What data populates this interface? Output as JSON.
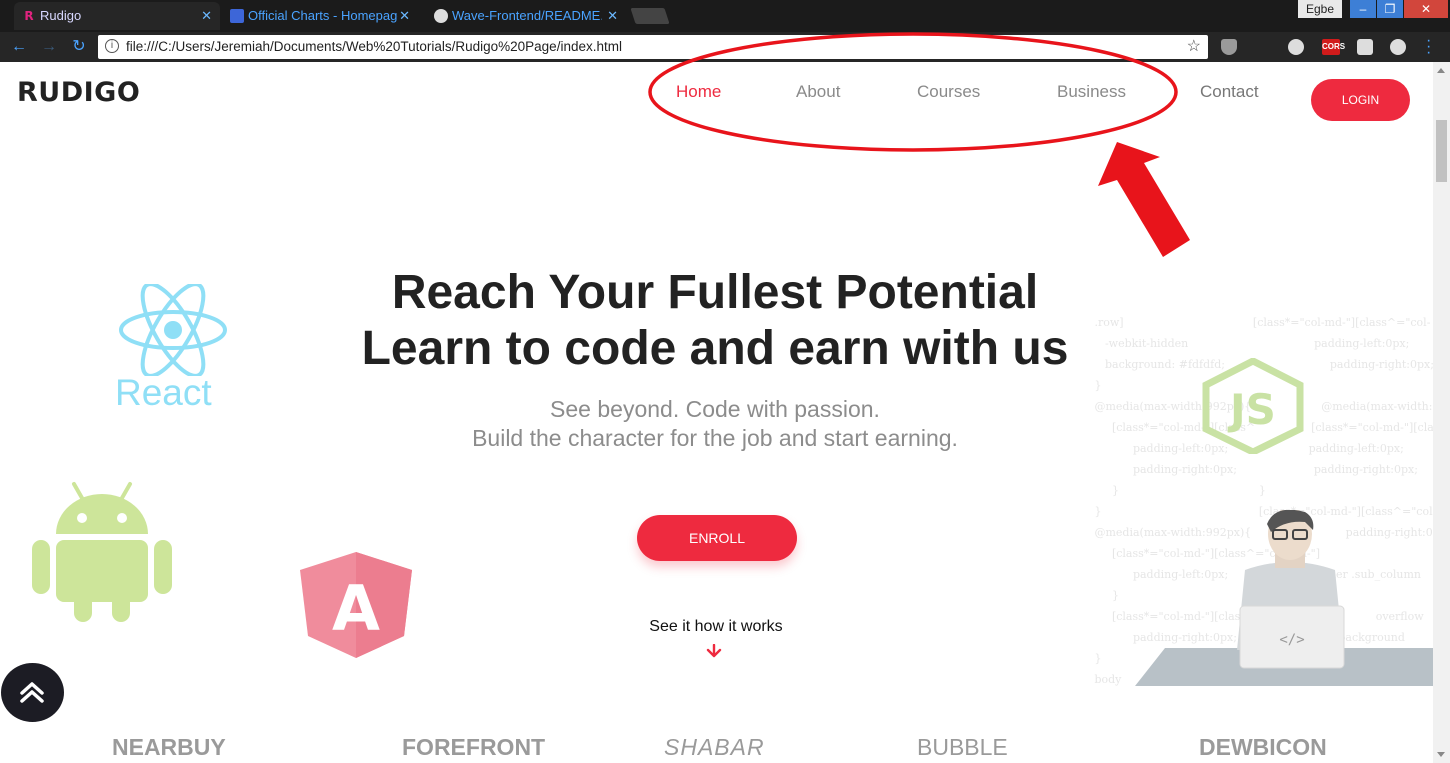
{
  "browser": {
    "tabs": [
      {
        "title": "Rudigo",
        "favicon": "rudigo-r-icon"
      },
      {
        "title": "Official Charts - Homepage",
        "favicon": "official-charts-icon"
      },
      {
        "title": "Wave-Frontend/README.md",
        "favicon": "github-icon"
      }
    ],
    "profile": "Egbe",
    "url": "file:///C:/Users/Jeremiah/Documents/Web%20Tutorials/Rudigo%20Page/index.html",
    "extensions": {
      "cors_label": "CORS"
    },
    "window_controls": {
      "min": "–",
      "max": "❐",
      "close": "✕"
    }
  },
  "page": {
    "logo": "RUDIGO",
    "nav": [
      "Home",
      "About",
      "Courses",
      "Business",
      "Contact"
    ],
    "active_nav": "Home",
    "login": "LOGIN",
    "hero": {
      "title_line1": "Reach Your Fullest Potential",
      "title_line2": "Learn to code and earn with us",
      "sub_line1": "See beyond. Code with passion.",
      "sub_line2": "Build the character for the job and start earning."
    },
    "enroll": "ENROLL",
    "see_how": "See it how it works",
    "tech_icons": {
      "react_label": "React",
      "nodejs_label": "JS",
      "angular_label": "A"
    },
    "brands": [
      "NEARBUY",
      "FOREFRONT",
      "SHABAR",
      "BUBBLE",
      "DEWBICON"
    ]
  },
  "colors": {
    "accent": "#ee2a3f",
    "nav_inactive": "#8a8a8a",
    "annotation_red": "#e8141b",
    "react": "#8fdff6",
    "android": "#cde59a",
    "angular": "#f08c9c",
    "nodejs": "#c9e2a4"
  }
}
